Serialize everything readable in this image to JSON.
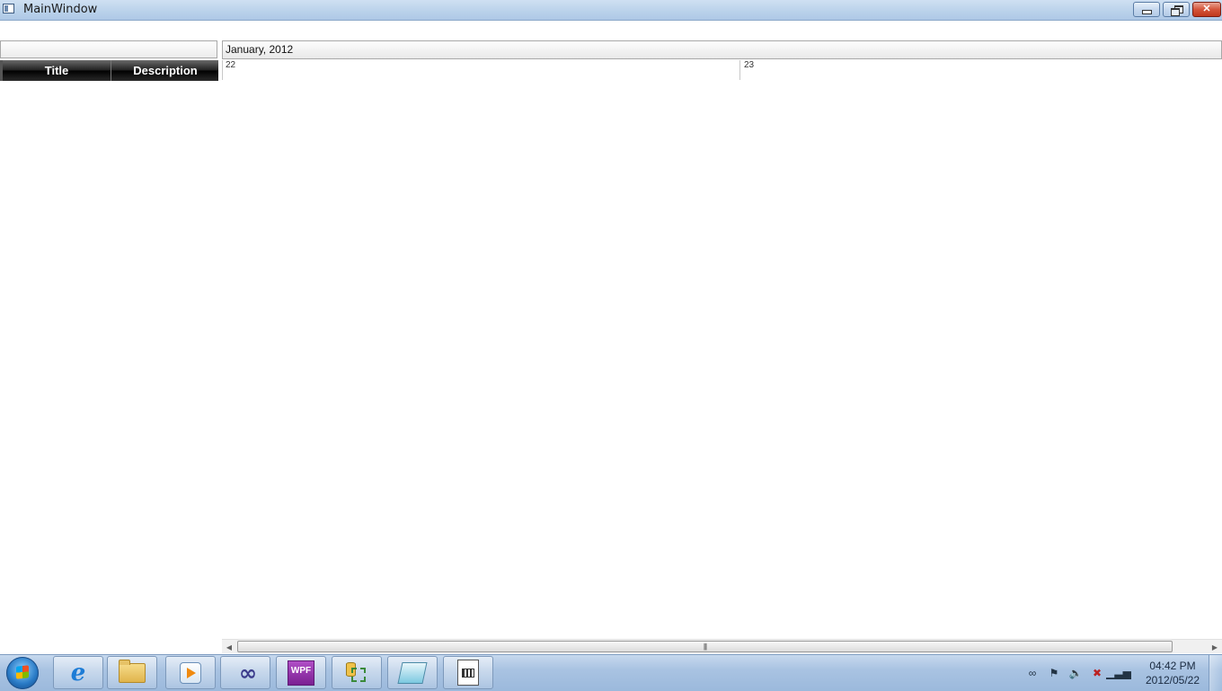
{
  "window": {
    "title": "MainWindow",
    "buttons": {
      "minimize": "minimize",
      "maximize": "restore",
      "close": "✕"
    }
  },
  "grid": {
    "columns": [
      "Title",
      "Description"
    ]
  },
  "timeline": {
    "month_label": "January, 2012",
    "days": [
      "22",
      "23"
    ]
  },
  "scrollbar": {
    "left_arrow": "◀",
    "right_arrow": "▶",
    "thumb_grip": "|||"
  },
  "taskbar": {
    "apps": [
      {
        "name": "internet-explorer",
        "icon": "ie-icon"
      },
      {
        "name": "windows-explorer",
        "icon": "folder-icon"
      },
      {
        "name": "media-player",
        "icon": "media-player-icon"
      },
      {
        "name": "visual-studio",
        "icon": "visual-studio-icon"
      },
      {
        "name": "wpf-app",
        "icon": "wpf-icon",
        "label": "WPF"
      },
      {
        "name": "tools-app",
        "icon": "tools-icon"
      },
      {
        "name": "notes-app",
        "icon": "notes-icon"
      },
      {
        "name": "document-app",
        "icon": "document-icon"
      }
    ],
    "tray": {
      "icons": [
        "network-icon",
        "flag-icon",
        "volume-icon",
        "action-center-icon",
        "signal-icon"
      ]
    },
    "clock": {
      "time": "04:42 PM",
      "date": "2012/05/22"
    }
  }
}
